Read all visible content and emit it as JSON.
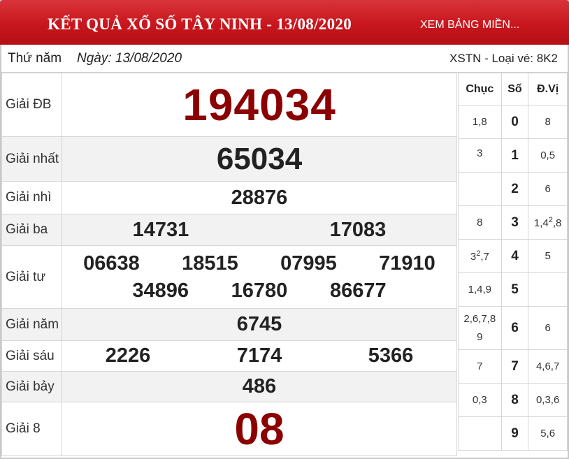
{
  "header": {
    "title": "KẾT QUẢ XỔ SỐ TÂY NINH - 13/08/2020",
    "link": "XEM BẢNG MIỀN..."
  },
  "info": {
    "day": "Thứ năm",
    "date": "Ngày: 13/08/2020",
    "code": "XSTN - Loại vé: 8K2"
  },
  "prizes": {
    "db": {
      "label": "Giải ĐB",
      "values": [
        "194034"
      ]
    },
    "g1": {
      "label": "Giải nhất",
      "values": [
        "65034"
      ]
    },
    "g2": {
      "label": "Giải nhì",
      "values": [
        "28876"
      ]
    },
    "g3": {
      "label": "Giải ba",
      "values": [
        "14731",
        "17083"
      ]
    },
    "g4": {
      "label": "Giải tư",
      "values": [
        "06638",
        "18515",
        "07995",
        "71910",
        "34896",
        "16780",
        "86677"
      ]
    },
    "g5": {
      "label": "Giải năm",
      "values": [
        "6745"
      ]
    },
    "g6": {
      "label": "Giải sáu",
      "values": [
        "2226",
        "7174",
        "5366"
      ]
    },
    "g7": {
      "label": "Giải bảy",
      "values": [
        "486"
      ]
    },
    "g8": {
      "label": "Giải 8",
      "values": [
        "08"
      ]
    }
  },
  "loto": {
    "headers": {
      "chuc": "Chục",
      "so": "Số",
      "dvi": "Đ.Vị"
    },
    "rows": [
      {
        "chuc": "1,8",
        "so": "0",
        "dvi": "8"
      },
      {
        "chuc": "3",
        "so": "1",
        "dvi": "0,5"
      },
      {
        "chuc": "",
        "so": "2",
        "dvi": "6"
      },
      {
        "chuc": "8",
        "so": "3",
        "dvi": "1,4",
        "dvi_sup": "2",
        "dvi_tail": ",8"
      },
      {
        "chuc": "3",
        "chuc_sup": "2",
        "chuc_tail": ",7",
        "so": "4",
        "dvi": "5"
      },
      {
        "chuc": "1,4,9",
        "so": "5",
        "dvi": ""
      },
      {
        "chuc": "2,6,7,8",
        "chuc_line2": "9",
        "so": "6",
        "dvi": "6"
      },
      {
        "chuc": "7",
        "so": "7",
        "dvi": "4,6,7"
      },
      {
        "chuc": "0,3",
        "so": "8",
        "dvi": "0,3,6"
      },
      {
        "chuc": "",
        "so": "9",
        "dvi": "5,6"
      }
    ]
  },
  "colors": {
    "header_bg": "#c8161d",
    "special_prize": "#8b0000",
    "alt_row": "#f2f2f2"
  }
}
